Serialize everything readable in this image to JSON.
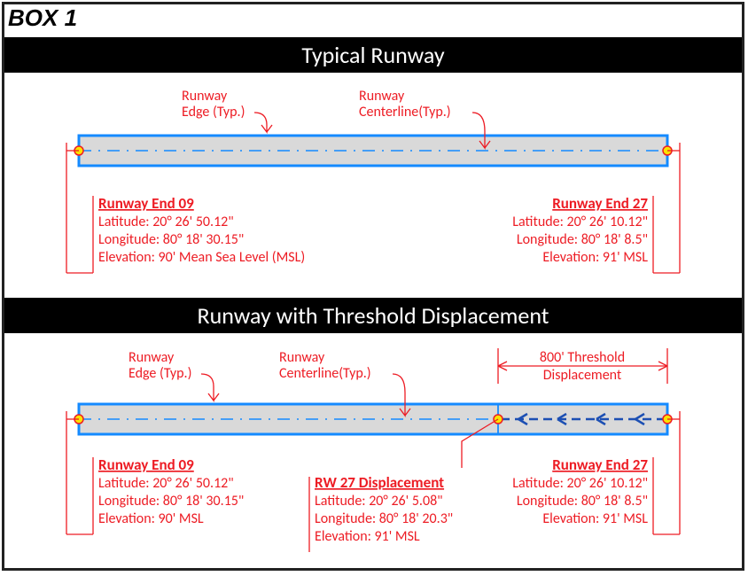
{
  "box_label": "BOX 1",
  "titles": {
    "typical": "Typical Runway",
    "displaced": "Runway with Threshold Displacement"
  },
  "labels": {
    "edge": "Runway",
    "edge2": "Edge (Typ.)",
    "centerline": "Runway",
    "centerline2": "Centerline(Typ.)",
    "threshold1": "800' Threshold",
    "threshold2": "Displacement"
  },
  "end09": {
    "title": "Runway  End 09",
    "lat": "Latitude: 20° 26' 50.12\"",
    "lon": "Longitude: 80° 18' 30.15\"",
    "elev_long": "Elevation: 90' Mean Sea Level (MSL)",
    "elev": "Elevation: 90' MSL"
  },
  "end27": {
    "title": "Runway  End 27",
    "lat": "Latitude: 20° 26' 10.12\"",
    "lon": "Longitude: 80° 18' 8.5\"",
    "elev": "Elevation: 91' MSL"
  },
  "disp27": {
    "title": "RW  27 Displacement",
    "lat": "Latitude: 20° 26' 5.08\"",
    "lon": "Longitude: 80° 18' 20.3\"",
    "elev": "Elevation: 91' MSL"
  }
}
